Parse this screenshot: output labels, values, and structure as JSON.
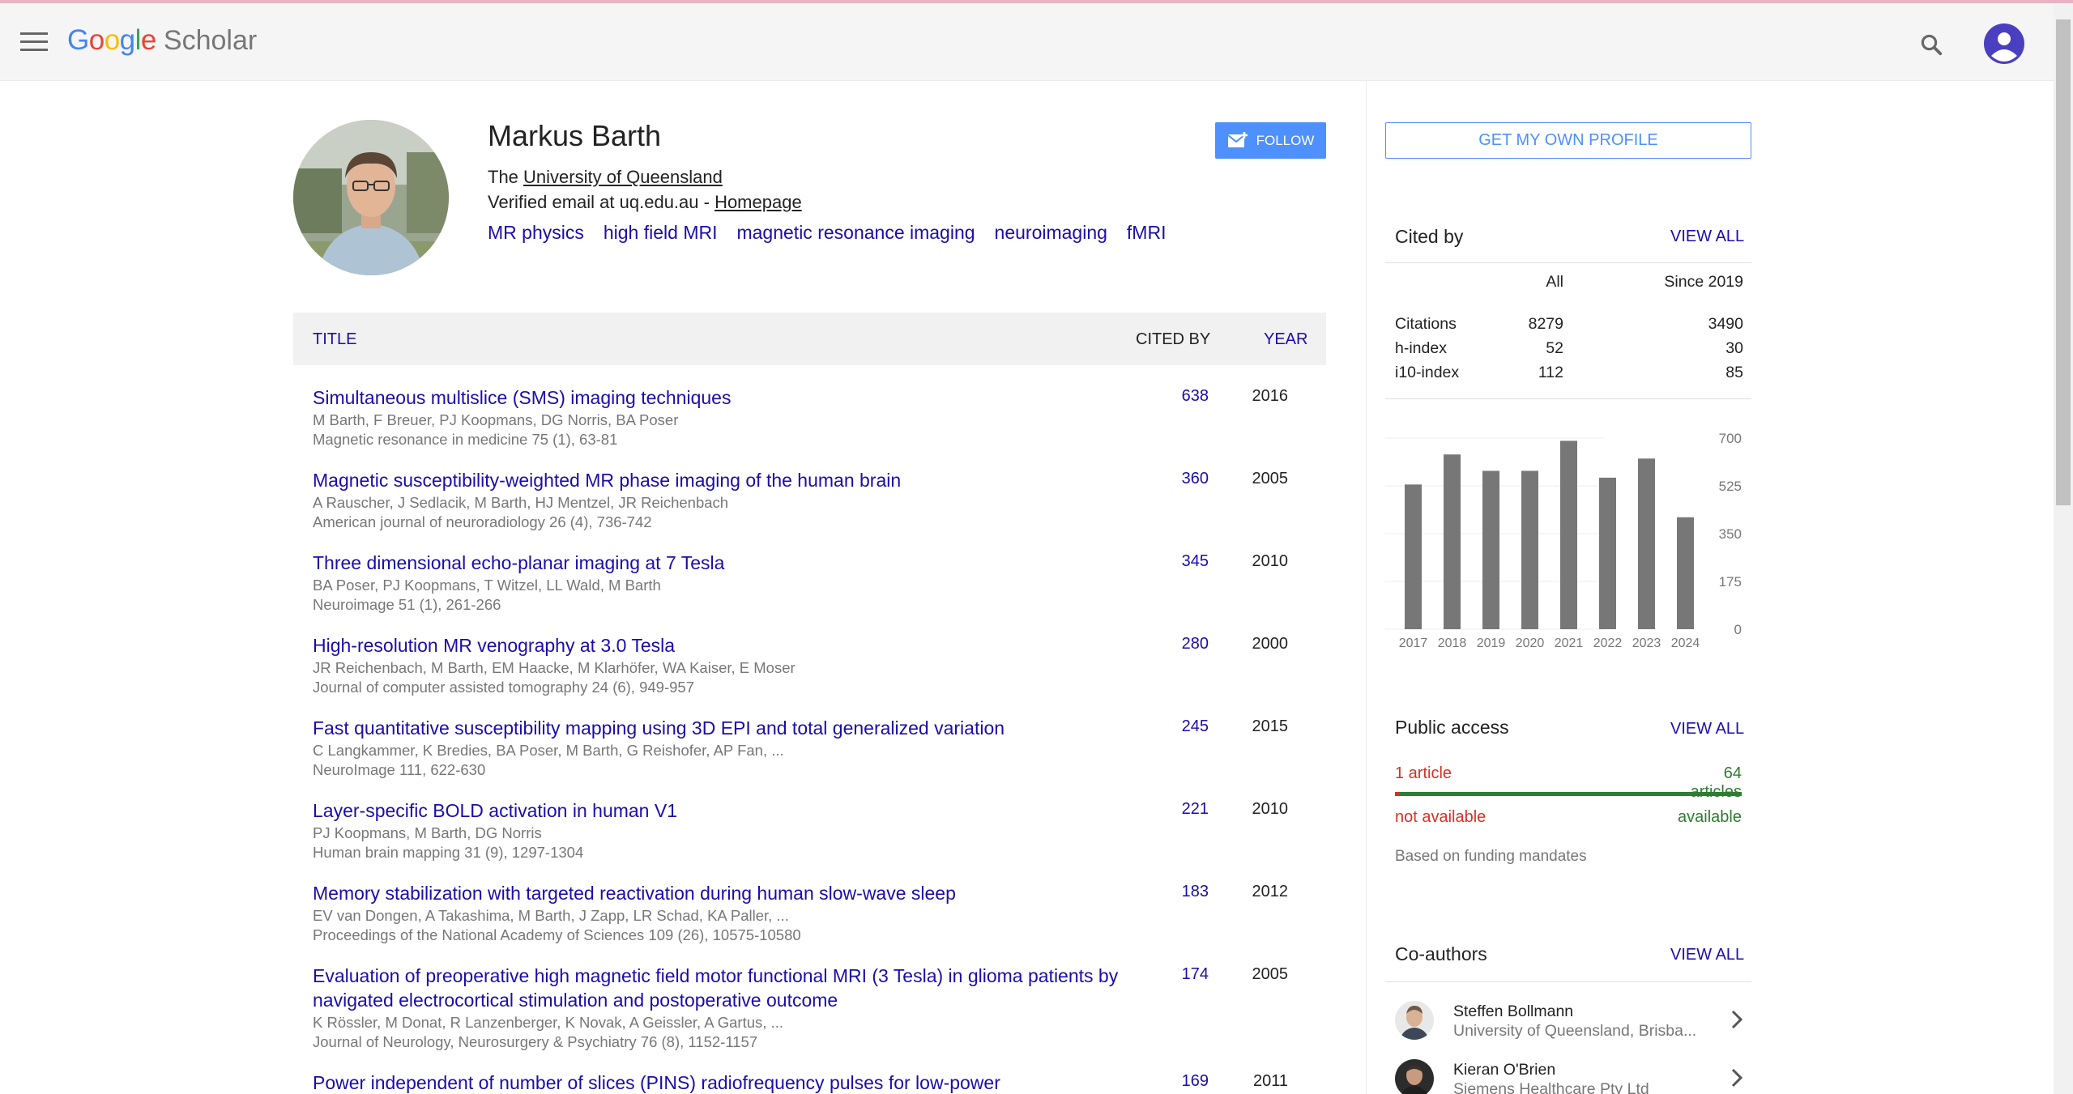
{
  "header": {
    "logo_letters": [
      "G",
      "o",
      "o",
      "g",
      "l",
      "e"
    ],
    "logo_colors": [
      "#4285f4",
      "#ea4335",
      "#fbbc05",
      "#4285f4",
      "#34a853",
      "#ea4335"
    ],
    "logo_suffix": "Scholar"
  },
  "profile": {
    "name": "Markus Barth",
    "affiliation_prefix": "The ",
    "affiliation_link": "University of Queensland",
    "email_text": "Verified email at uq.edu.au - ",
    "homepage_link": "Homepage",
    "interests": [
      "MR physics",
      "high field MRI",
      "magnetic resonance imaging",
      "neuroimaging",
      "fMRI"
    ],
    "follow_label": "FOLLOW"
  },
  "table": {
    "col_title": "TITLE",
    "col_cited": "CITED BY",
    "col_year": "YEAR",
    "rows": [
      {
        "title": "Simultaneous multislice (SMS) imaging techniques",
        "authors": "M Barth, F Breuer, PJ Koopmans, DG Norris, BA Poser",
        "venue": "Magnetic resonance in medicine 75 (1), 63-81",
        "cited": "638",
        "year": "2016"
      },
      {
        "title": "Magnetic susceptibility-weighted MR phase imaging of the human brain",
        "authors": "A Rauscher, J Sedlacik, M Barth, HJ Mentzel, JR Reichenbach",
        "venue": "American journal of neuroradiology 26 (4), 736-742",
        "cited": "360",
        "year": "2005"
      },
      {
        "title": "Three dimensional echo-planar imaging at 7 Tesla",
        "authors": "BA Poser, PJ Koopmans, T Witzel, LL Wald, M Barth",
        "venue": "Neuroimage 51 (1), 261-266",
        "cited": "345",
        "year": "2010"
      },
      {
        "title": "High-resolution MR venography at 3.0 Tesla",
        "authors": "JR Reichenbach, M Barth, EM Haacke, M Klarhöfer, WA Kaiser, E Moser",
        "venue": "Journal of computer assisted tomography 24 (6), 949-957",
        "cited": "280",
        "year": "2000"
      },
      {
        "title": "Fast quantitative susceptibility mapping using 3D EPI and total generalized variation",
        "authors": "C Langkammer, K Bredies, BA Poser, M Barth, G Reishofer, AP Fan, ...",
        "venue": "NeuroImage 111, 622-630",
        "cited": "245",
        "year": "2015"
      },
      {
        "title": "Layer-specific BOLD activation in human V1",
        "authors": "PJ Koopmans, M Barth, DG Norris",
        "venue": "Human brain mapping 31 (9), 1297-1304",
        "cited": "221",
        "year": "2010"
      },
      {
        "title": "Memory stabilization with targeted reactivation during human slow-wave sleep",
        "authors": "EV van Dongen, A Takashima, M Barth, J Zapp, LR Schad, KA Paller, ...",
        "venue": "Proceedings of the National Academy of Sciences 109 (26), 10575-10580",
        "cited": "183",
        "year": "2012"
      },
      {
        "title": "Evaluation of preoperative high magnetic field motor functional MRI (3 Tesla) in glioma patients by navigated electrocortical stimulation and postoperative outcome",
        "authors": "K Rössler, M Donat, R Lanzenberger, K Novak, A Geissler, A Gartus, ...",
        "venue": "Journal of Neurology, Neurosurgery & Psychiatry 76 (8), 1152-1157",
        "cited": "174",
        "year": "2005"
      },
      {
        "title": "Power independent of number of slices (PINS) radiofrequency pulses for low-power",
        "authors": "",
        "venue": "",
        "cited": "169",
        "year": "2011"
      }
    ]
  },
  "sidebar": {
    "own_profile_label": "GET MY OWN PROFILE",
    "cited_by": {
      "title": "Cited by",
      "view_all": "VIEW ALL",
      "col_all": "All",
      "col_since": "Since 2019",
      "rows": [
        {
          "label": "Citations",
          "all": "8279",
          "since": "3490"
        },
        {
          "label": "h-index",
          "all": "52",
          "since": "30"
        },
        {
          "label": "i10-index",
          "all": "112",
          "since": "85"
        }
      ]
    },
    "public_access": {
      "title": "Public access",
      "view_all": "VIEW ALL",
      "left_count": "1 article",
      "right_count": "64 articles",
      "left_label": "not available",
      "right_label": "available",
      "note": "Based on funding mandates",
      "available_fraction": 0.985
    },
    "coauthors": {
      "title": "Co-authors",
      "view_all": "VIEW ALL",
      "items": [
        {
          "name": "Steffen Bollmann",
          "affiliation": "University of Queensland, Brisba..."
        },
        {
          "name": "Kieran O'Brien",
          "affiliation": "Siemens Healthcare Pty Ltd"
        }
      ]
    }
  },
  "colors": {
    "link": "#1a0dab",
    "accent": "#4d90fe",
    "bar": "#777777",
    "not_available": "#d93025",
    "available": "#2e7d32"
  },
  "chart_data": {
    "type": "bar",
    "categories": [
      "2017",
      "2018",
      "2019",
      "2020",
      "2021",
      "2022",
      "2023",
      "2024"
    ],
    "values": [
      530,
      640,
      580,
      580,
      690,
      555,
      625,
      410
    ],
    "yticks": [
      "700",
      "525",
      "350",
      "175",
      "0"
    ],
    "ylim": [
      0,
      700
    ]
  }
}
